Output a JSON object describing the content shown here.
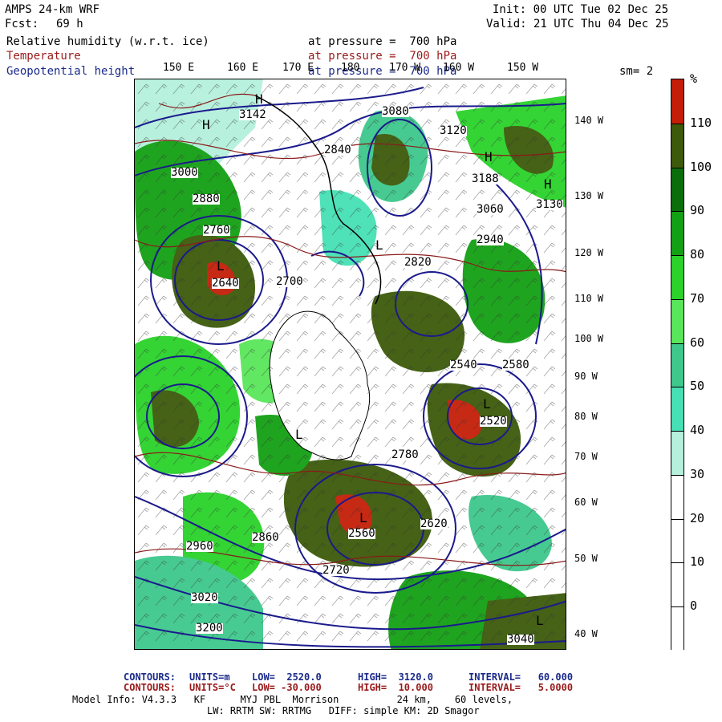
{
  "header": {
    "title": "AMPS 24-km WRF",
    "fcst_label": "Fcst:",
    "fcst_value": "69 h",
    "init": "Init: 00 UTC Tue 02 Dec 25",
    "valid": "Valid: 21 UTC Thu 04 Dec 25",
    "fields": [
      {
        "name": "Relative humidity (w.r.t. ice)",
        "level": "at pressure =  700 hPa"
      },
      {
        "name": "Temperature",
        "level": "at pressure =  700 hPa"
      },
      {
        "name": "Geopotential height",
        "level": "at pressure =  700 hPa"
      }
    ],
    "smoothing": "sm= 2"
  },
  "axes": {
    "lon_top": [
      "150 E",
      "160 E",
      "170 E",
      "180",
      "170 W",
      "160 W",
      "150 W"
    ],
    "lat_right": [
      "140 W",
      "130 W",
      "120 W",
      "110 W",
      "100 W",
      "90 W",
      "80 W",
      "70 W",
      "60 W",
      "50 W",
      "40 W"
    ]
  },
  "colorbar": {
    "unit": "%",
    "ticks": [
      "110",
      "100",
      "90",
      "80",
      "70",
      "60",
      "50",
      "40",
      "30",
      "20",
      "10",
      "0"
    ],
    "colors": [
      "#c41e08",
      "#3c5a0a",
      "#0a6e0a",
      "#14a014",
      "#2ad22a",
      "#5ae65a",
      "#3ec88c",
      "#46e0b4",
      "#b4f0dc",
      "#ffffff",
      "#ffffff",
      "#ffffff",
      "#ffffff"
    ]
  },
  "contour_labels": {
    "height_values": [
      "3142",
      "3080",
      "3120",
      "2840",
      "3000",
      "2880",
      "2760",
      "2640",
      "3188",
      "3060",
      "3130",
      "2940",
      "2700",
      "2820",
      "2540",
      "2580",
      "2520",
      "2780",
      "2560",
      "2620",
      "2960",
      "3020",
      "2860",
      "2720",
      "3200",
      "3040"
    ],
    "highs_lows": [
      "H",
      "H",
      "H",
      "H",
      "L",
      "L",
      "L",
      "L",
      "L",
      "L"
    ]
  },
  "footer": {
    "line1_label": "CONTOURS:",
    "line1_units": "UNITS=m",
    "line1_low": "LOW=  2520.0",
    "line1_high": "HIGH=  3120.0",
    "line1_interval": "INTERVAL=   60.000",
    "line2_label": "CONTOURS:",
    "line2_units": "UNITS=°C",
    "line2_low": "LOW= -30.000",
    "line2_high": "HIGH=  10.000",
    "line2_interval": "INTERVAL=   5.0000",
    "model_info": "Model Info: V4.3.3   KF      MYJ PBL  Morrison          24 km,    60 levels,",
    "physics": "LW: RRTM SW: RRTMG   DIFF: simple KM: 2D Smagor"
  },
  "colors": {
    "height_contour": "#1a1a8c",
    "temp_contour": "#8b1a1a",
    "coast": "#000000"
  }
}
